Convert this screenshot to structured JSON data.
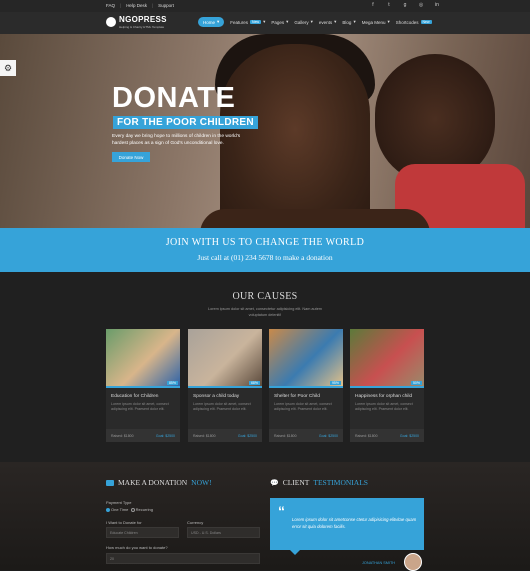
{
  "topbar": {
    "links": [
      "FAQ",
      "Help Desk",
      "Support"
    ],
    "social": [
      "facebook-icon",
      "twitter-icon",
      "google-plus-icon",
      "instagram-icon",
      "linkedin-icon"
    ]
  },
  "brand": {
    "name": "NGOPRESS",
    "tagline": "Helping & Charity HTML Template"
  },
  "nav": [
    {
      "label": "Home",
      "active": true,
      "badge": ""
    },
    {
      "label": "Features",
      "badge": "New"
    },
    {
      "label": "Pages",
      "badge": ""
    },
    {
      "label": "Gallery",
      "badge": ""
    },
    {
      "label": "events",
      "badge": ""
    },
    {
      "label": "Blog",
      "badge": ""
    },
    {
      "label": "Mega Menu",
      "badge": ""
    },
    {
      "label": "Shortcodes",
      "badge": "New"
    }
  ],
  "hero": {
    "title": "DONATE",
    "subtitle": "FOR THE POOR CHILDREN",
    "desc": "Every day we bring hope to millions of children in the world's hardest places as a sign of God's unconditional love.",
    "button": "Donate Now"
  },
  "join": {
    "heading": "JOIN WITH US TO CHANGE THE WORLD",
    "subheading": "Just call at (01) 234 5678 to make a donation"
  },
  "causes": {
    "title": "OUR CAUSES",
    "subtitle": "Lorem ipsum dolor sit amet, consectetur adipisicing elit. Nam autem voluptatum deleniti!",
    "items": [
      {
        "title": "Education for Children",
        "desc": "Lorem ipsum dolor sit amet, consect adipiscing elit. Praesent dolor elit.",
        "raised": "Raised: $1800",
        "goal": "Goal: $2500",
        "pct": "85%",
        "colors": [
          "#6a9c6a",
          "#d8b58a",
          "#2e63a8"
        ]
      },
      {
        "title": "Sponsor a child today",
        "desc": "Lorem ipsum dolor sit amet, consect adipiscing elit. Praesent dolor elit.",
        "raised": "Raised: $1800",
        "goal": "Goal: $2500",
        "pct": "68%",
        "colors": [
          "#a9a29a",
          "#c9b49c",
          "#5b4a3c"
        ]
      },
      {
        "title": "Shelter for Poor Child",
        "desc": "Lorem ipsum dolor sit amet, consect adipiscing elit. Praesent dolor elit.",
        "raised": "Raised: $1800",
        "goal": "Goal: $2500",
        "pct": "95%",
        "colors": [
          "#c98a4a",
          "#3b7bb0",
          "#e0c08a"
        ]
      },
      {
        "title": "Happiness for orphan child",
        "desc": "Lorem ipsum dolor sit amet, consect adipiscing elit. Praesent dolor elit.",
        "raised": "Raised: $1800",
        "goal": "Goal: $2500",
        "pct": "50%",
        "colors": [
          "#5c7a3a",
          "#c85050",
          "#9a8a6a"
        ]
      }
    ]
  },
  "donation": {
    "title": "MAKE A DONATION",
    "title_accent": "NOW!",
    "payment_type": "Payment Type",
    "one_time": "One Time",
    "recurring": "Recurring",
    "donate_to": "I Want to Donate for",
    "donate_to_value": "Educate Children",
    "currency": "Currency",
    "currency_value": "USD - U.S. Dollars",
    "how_much": "How much do you want to donate?",
    "amount_value": "20"
  },
  "testimonials": {
    "title": "CLIENT",
    "title_accent": "TESTIMONIALS",
    "quote": "Lorem ipsum dolor sit ametconse ctetur adipisicing elitvitae quam error sit quia dolorem facilis.",
    "author": "JONATHAN SMITH"
  },
  "accent_color": "#36a3d9"
}
